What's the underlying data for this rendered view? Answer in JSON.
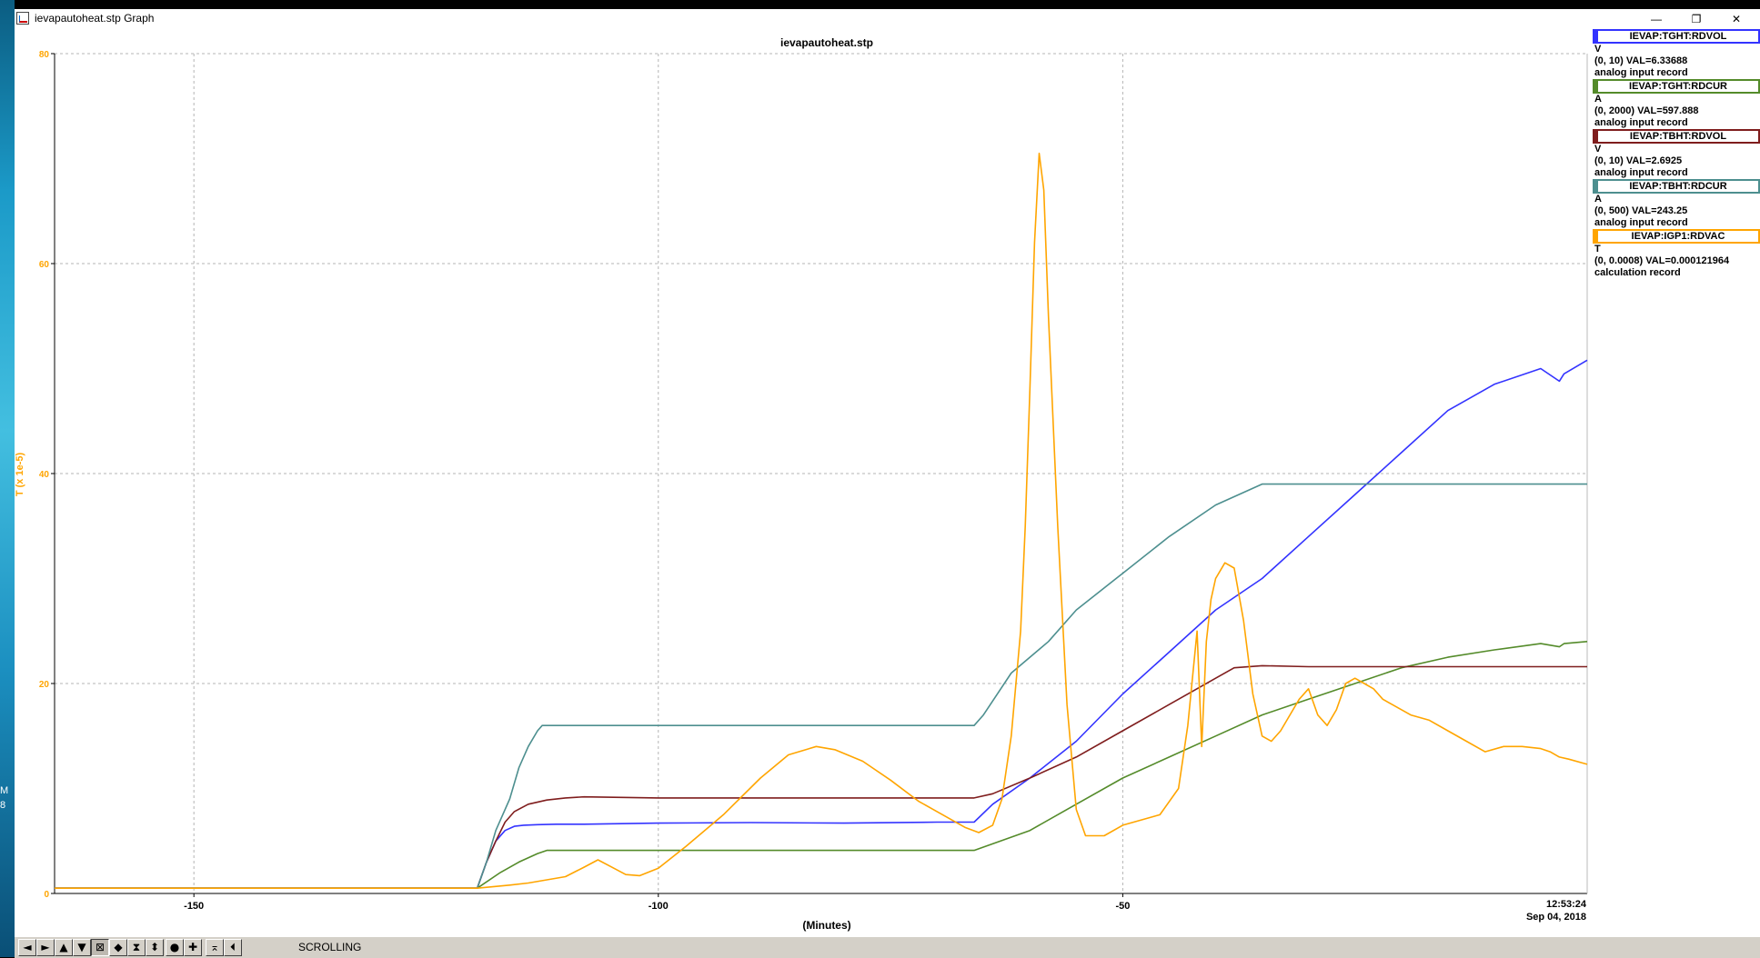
{
  "desktop": {
    "label_1": "M",
    "label_2": "8"
  },
  "window": {
    "title": "ievapautoheat.stp Graph",
    "controls": {
      "minimize": "—",
      "restore": "❐",
      "close": "✕"
    }
  },
  "chart_data": {
    "type": "line",
    "title": "ievapautoheat.stp",
    "xlabel": "(Minutes)",
    "ylabel": "T (x 1e-5)",
    "ylabel_color": "#ffa500",
    "xlim": [
      -165,
      0
    ],
    "ylim": [
      0,
      80
    ],
    "xticks": [
      -150,
      -100,
      -50
    ],
    "yticks": [
      0,
      20,
      40,
      60,
      80
    ],
    "grid": true,
    "end_time": "12:53:24",
    "end_date": "Sep 04, 2018",
    "series": [
      {
        "name": "IEVAP:TGHT:RDVOL",
        "color": "#3333ff",
        "scale_max": 10,
        "x": [
          -165,
          -119.5,
          -118.5,
          -117.5,
          -116.5,
          -115.5,
          -114.5,
          -113,
          -111,
          -108,
          -100,
          -90,
          -80,
          -70,
          -66,
          -64,
          -60,
          -55,
          -50,
          -45,
          -40,
          -35,
          -30,
          -25,
          -20,
          -15,
          -10,
          -5,
          -3,
          -2.5,
          0
        ],
        "y": [
          0.5,
          0.5,
          3,
          5,
          6,
          6.4,
          6.5,
          6.55,
          6.6,
          6.6,
          6.7,
          6.75,
          6.7,
          6.8,
          6.8,
          8.5,
          11,
          14.5,
          19,
          23,
          27,
          30,
          34,
          38,
          42,
          46,
          48.5,
          50,
          48.8,
          49.5,
          50.8
        ]
      },
      {
        "name": "IEVAP:TGHT:RDCUR",
        "color": "#548b2a",
        "scale_max": 2000,
        "x": [
          -165,
          -119.5,
          -117,
          -115,
          -113,
          -112,
          -100,
          -90,
          -80,
          -70,
          -66,
          -60,
          -55,
          -50,
          -45,
          -40,
          -35,
          -30,
          -25,
          -20,
          -15,
          -10,
          -5,
          -3,
          -2.5,
          0
        ],
        "y": [
          0.5,
          0.5,
          2,
          3,
          3.8,
          4.1,
          4.1,
          4.1,
          4.1,
          4.1,
          4.1,
          6,
          8.5,
          11,
          13,
          15,
          17,
          18.5,
          20,
          21.5,
          22.5,
          23.2,
          23.8,
          23.5,
          23.8,
          24
        ]
      },
      {
        "name": "IEVAP:TBHT:RDVOL",
        "color": "#7f1d1d",
        "scale_max": 10,
        "x": [
          -165,
          -119.5,
          -118.5,
          -117.5,
          -116.5,
          -115.5,
          -114,
          -112,
          -110,
          -108,
          -100,
          -90,
          -80,
          -70,
          -66,
          -64,
          -60,
          -55,
          -50,
          -45,
          -40,
          -38,
          -35,
          -30,
          -25,
          -20,
          -15,
          -10,
          -5,
          0
        ],
        "y": [
          0.5,
          0.5,
          3,
          5,
          6.8,
          7.8,
          8.5,
          8.9,
          9.1,
          9.2,
          9.1,
          9.1,
          9.1,
          9.1,
          9.1,
          9.5,
          11,
          13,
          15.5,
          18,
          20.5,
          21.5,
          21.7,
          21.6,
          21.6,
          21.6,
          21.6,
          21.6,
          21.6,
          21.6
        ]
      },
      {
        "name": "IEVAP:TBHT:RDCUR",
        "color": "#4d8f8f",
        "scale_max": 500,
        "x": [
          -165,
          -119.5,
          -118.5,
          -117.5,
          -116,
          -115,
          -114,
          -113,
          -112.5,
          -100,
          -90,
          -80,
          -70,
          -66,
          -65,
          -62,
          -58,
          -55,
          -50,
          -45,
          -40,
          -35,
          -30,
          -20,
          -10,
          0
        ],
        "y": [
          0.5,
          0.5,
          3,
          6,
          9,
          12,
          14,
          15.5,
          16,
          16,
          16,
          16,
          16,
          16,
          17,
          21,
          24,
          27,
          30.5,
          34,
          37,
          39,
          39,
          39,
          39,
          39
        ]
      },
      {
        "name": "IEVAP:IGP1:RDVAC",
        "color": "#ffa500",
        "scale_max": 0.0008,
        "x": [
          -165,
          -119.5,
          -116,
          -114,
          -110,
          -108,
          -106.5,
          -105,
          -103.5,
          -102,
          -100,
          -97,
          -93,
          -89,
          -86,
          -83,
          -81,
          -78,
          -75,
          -72,
          -69,
          -67,
          -65.5,
          -64,
          -63,
          -62,
          -61,
          -60.5,
          -60,
          -59.5,
          -59,
          -58.5,
          -58,
          -57,
          -56,
          -55,
          -54,
          -52,
          -50,
          -48,
          -46,
          -44,
          -43,
          -42,
          -41.5,
          -41,
          -40.5,
          -40,
          -39,
          -38,
          -37,
          -36,
          -35,
          -34,
          -33,
          -32,
          -31,
          -30,
          -29,
          -28,
          -27,
          -26,
          -25,
          -24,
          -23,
          -22,
          -21,
          -19,
          -17,
          -15,
          -13,
          -11,
          -9,
          -7,
          -5,
          -4,
          -3,
          -2,
          0
        ],
        "y": [
          0.5,
          0.5,
          0.8,
          1,
          1.6,
          2.5,
          3.2,
          2.5,
          1.8,
          1.7,
          2.4,
          4.5,
          7.5,
          11,
          13.2,
          14,
          13.7,
          12.6,
          10.8,
          8.8,
          7.3,
          6.3,
          5.8,
          6.5,
          9,
          15,
          25,
          35,
          48,
          62,
          70.5,
          67,
          55,
          35,
          18,
          8,
          5.5,
          5.5,
          6.5,
          7,
          7.5,
          10,
          16,
          25,
          14,
          24,
          28,
          30,
          31.5,
          31,
          26,
          19,
          15,
          14.5,
          15.5,
          17,
          18.5,
          19.5,
          17,
          16,
          17.5,
          20,
          20.5,
          20,
          19.5,
          18.5,
          18,
          17,
          16.5,
          15.5,
          14.5,
          13.5,
          14,
          14,
          13.8,
          13.5,
          13,
          12.8,
          12.3
        ]
      }
    ]
  },
  "legend": [
    {
      "name": "IEVAP:TGHT:RDVOL",
      "color": "#3333ff",
      "unit": "V",
      "range_val": "(0, 10) VAL=6.33688",
      "record": "analog input record"
    },
    {
      "name": "IEVAP:TGHT:RDCUR",
      "color": "#548b2a",
      "unit": "A",
      "range_val": "(0, 2000) VAL=597.888",
      "record": "analog input record"
    },
    {
      "name": "IEVAP:TBHT:RDVOL",
      "color": "#7f1d1d",
      "unit": "V",
      "range_val": "(0, 10) VAL=2.6925",
      "record": "analog input record"
    },
    {
      "name": "IEVAP:TBHT:RDCUR",
      "color": "#4d8f8f",
      "unit": "A",
      "range_val": "(0, 500) VAL=243.25",
      "record": "analog input record"
    },
    {
      "name": "IEVAP:IGP1:RDVAC",
      "color": "#ffa500",
      "unit": "T",
      "range_val": "(0, 0.0008) VAL=0.000121964",
      "record": "calculation record"
    }
  ],
  "toolbar": {
    "buttons": [
      {
        "name": "pan-left",
        "icon": "arrow-left-icon",
        "glyph": "◄"
      },
      {
        "name": "pan-right",
        "icon": "arrow-right-icon",
        "glyph": "►"
      },
      {
        "name": "pan-up",
        "icon": "arrow-up-icon",
        "glyph": "▲"
      },
      {
        "name": "pan-down",
        "icon": "arrow-down-icon",
        "glyph": "▼"
      },
      {
        "name": "zoom-box",
        "icon": "zoom-box-icon",
        "glyph": "⊠"
      },
      {
        "name": "zoom-x",
        "icon": "zoom-x-icon",
        "glyph": "◆"
      },
      {
        "name": "zoom-y-out",
        "icon": "zoom-y-icon",
        "glyph": "⧗"
      },
      {
        "name": "zoom-y",
        "icon": "zoom-y-in-icon",
        "glyph": "⬍"
      },
      {
        "name": "record",
        "icon": "circle-icon",
        "glyph": "●"
      },
      {
        "name": "add",
        "icon": "plus-icon",
        "glyph": "✚"
      },
      {
        "name": "autoscale",
        "icon": "autoscale-icon",
        "glyph": "⌅"
      },
      {
        "name": "scroll-mode",
        "icon": "scroll-icon",
        "glyph": "⏴"
      }
    ],
    "scroll_label": "SCROLLING"
  }
}
